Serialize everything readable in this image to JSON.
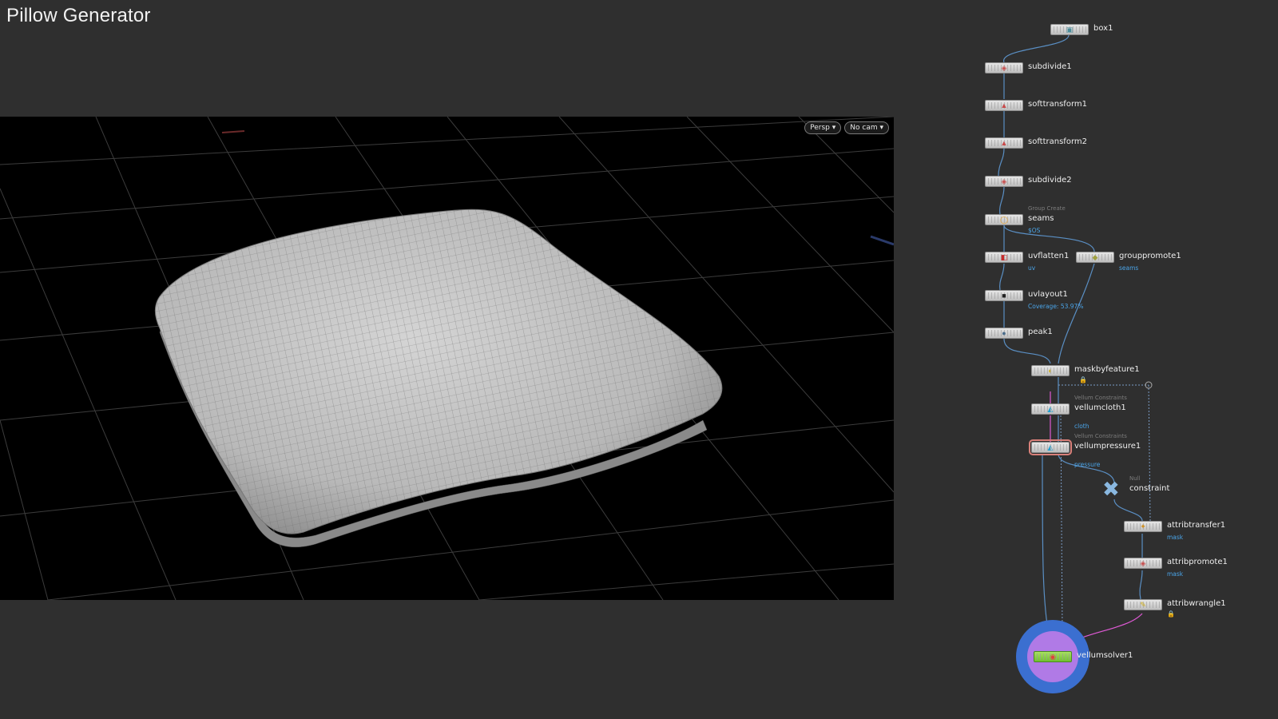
{
  "page": {
    "title": "Pillow Generator"
  },
  "viewport": {
    "menus": {
      "persp_label": "Persp",
      "cam_label": "No cam"
    }
  },
  "network": {
    "nodes": {
      "box1": {
        "name": "box1"
      },
      "subdivide1": {
        "name": "subdivide1"
      },
      "softtransform1": {
        "name": "softtransform1"
      },
      "softtransform2": {
        "name": "softtransform2"
      },
      "subdivide2": {
        "name": "subdivide2"
      },
      "seams": {
        "type": "Group Create",
        "name": "seams",
        "sub": "$OS"
      },
      "uvflatten1": {
        "name": "uvflatten1",
        "sub": "uv"
      },
      "grouppromote1": {
        "name": "grouppromote1",
        "sub": "seams"
      },
      "uvlayout1": {
        "name": "uvlayout1",
        "sub": "Coverage: 53.97%"
      },
      "peak1": {
        "name": "peak1"
      },
      "maskbyfeature1": {
        "name": "maskbyfeature1"
      },
      "vellumcloth1": {
        "type": "Vellum Constraints",
        "name": "vellumcloth1",
        "sub": "cloth"
      },
      "vellumpressure1": {
        "type": "Vellum Constraints",
        "name": "vellumpressure1",
        "sub": "pressure"
      },
      "constraint": {
        "type": "Null",
        "name": "constraint"
      },
      "attribtransfer1": {
        "name": "attribtransfer1",
        "sub": "mask"
      },
      "attribpromote1": {
        "name": "attribpromote1",
        "sub": "mask"
      },
      "attribwrangle1": {
        "name": "attribwrangle1"
      },
      "vellumsolver1": {
        "name": "vellumsolver1"
      }
    }
  },
  "colors": {
    "background": "#2f2f2f",
    "viewport_bg": "#000000",
    "wire": "#5a8fc4",
    "wire_pink": "#e05ad6",
    "label_blue": "#4aa4e8",
    "solver_ring": "#3b6fd0",
    "solver_inner": "#b07ae6"
  }
}
